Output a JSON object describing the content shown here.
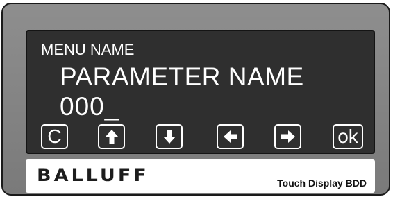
{
  "display": {
    "menu_name": "MENU NAME",
    "parameter_name": "PARAMETER NAME",
    "parameter_value": "000_"
  },
  "buttons": [
    {
      "label": "C",
      "icon": null
    },
    {
      "label": "",
      "icon": "arrow-up-icon"
    },
    {
      "label": "",
      "icon": "arrow-down-icon"
    },
    {
      "label": "",
      "icon": "arrow-left-icon"
    },
    {
      "label": "",
      "icon": "arrow-right-icon"
    },
    {
      "label": "ok",
      "icon": null
    }
  ],
  "brand": {
    "logo_text": "BALLUFF",
    "product_name": "Touch Display BDD"
  },
  "colors": {
    "bezel": "#838383",
    "screen": "#2f2f2f",
    "screen_text": "#ffffff",
    "label_panel": "#ffffff"
  }
}
